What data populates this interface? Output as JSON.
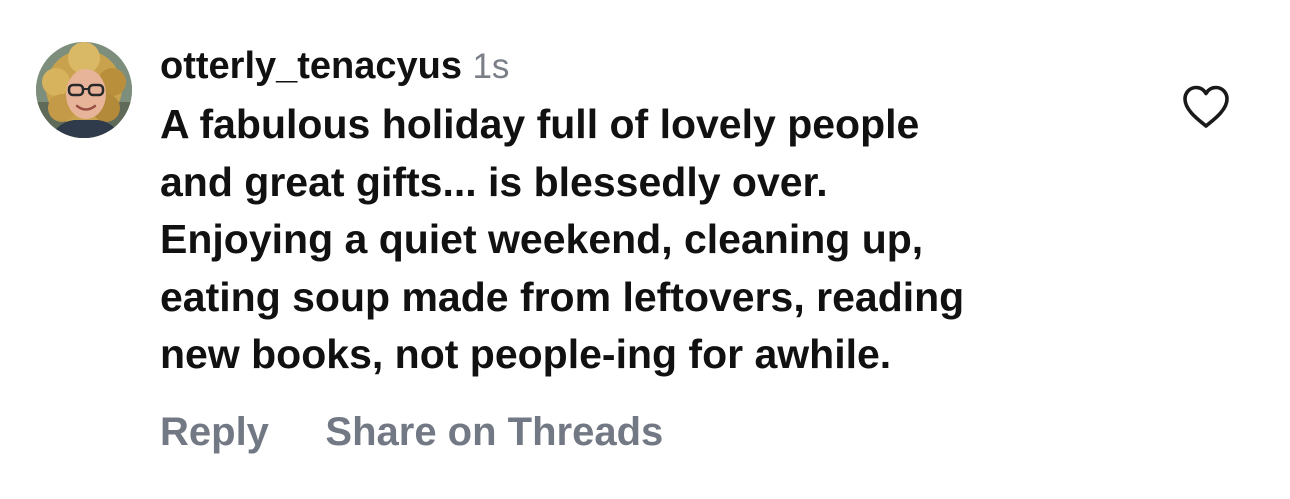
{
  "comment": {
    "username": "otterly_tenacyus",
    "time": "1s",
    "text_lines": [
      "A fabulous holiday full of lovely people",
      "and great gifts... is blessedly over.",
      "Enjoying a quiet weekend, cleaning up,",
      "eating soup made from leftovers, reading",
      "new books, not people-ing for awhile."
    ],
    "actions": {
      "reply_label": "Reply",
      "share_label": "Share on Threads"
    },
    "like_icon": "heart-outline-icon"
  },
  "colors": {
    "text": "#111111",
    "secondary_text": "#7a7f87",
    "action_text": "#737984",
    "icon": "#111111",
    "background": "#ffffff"
  }
}
